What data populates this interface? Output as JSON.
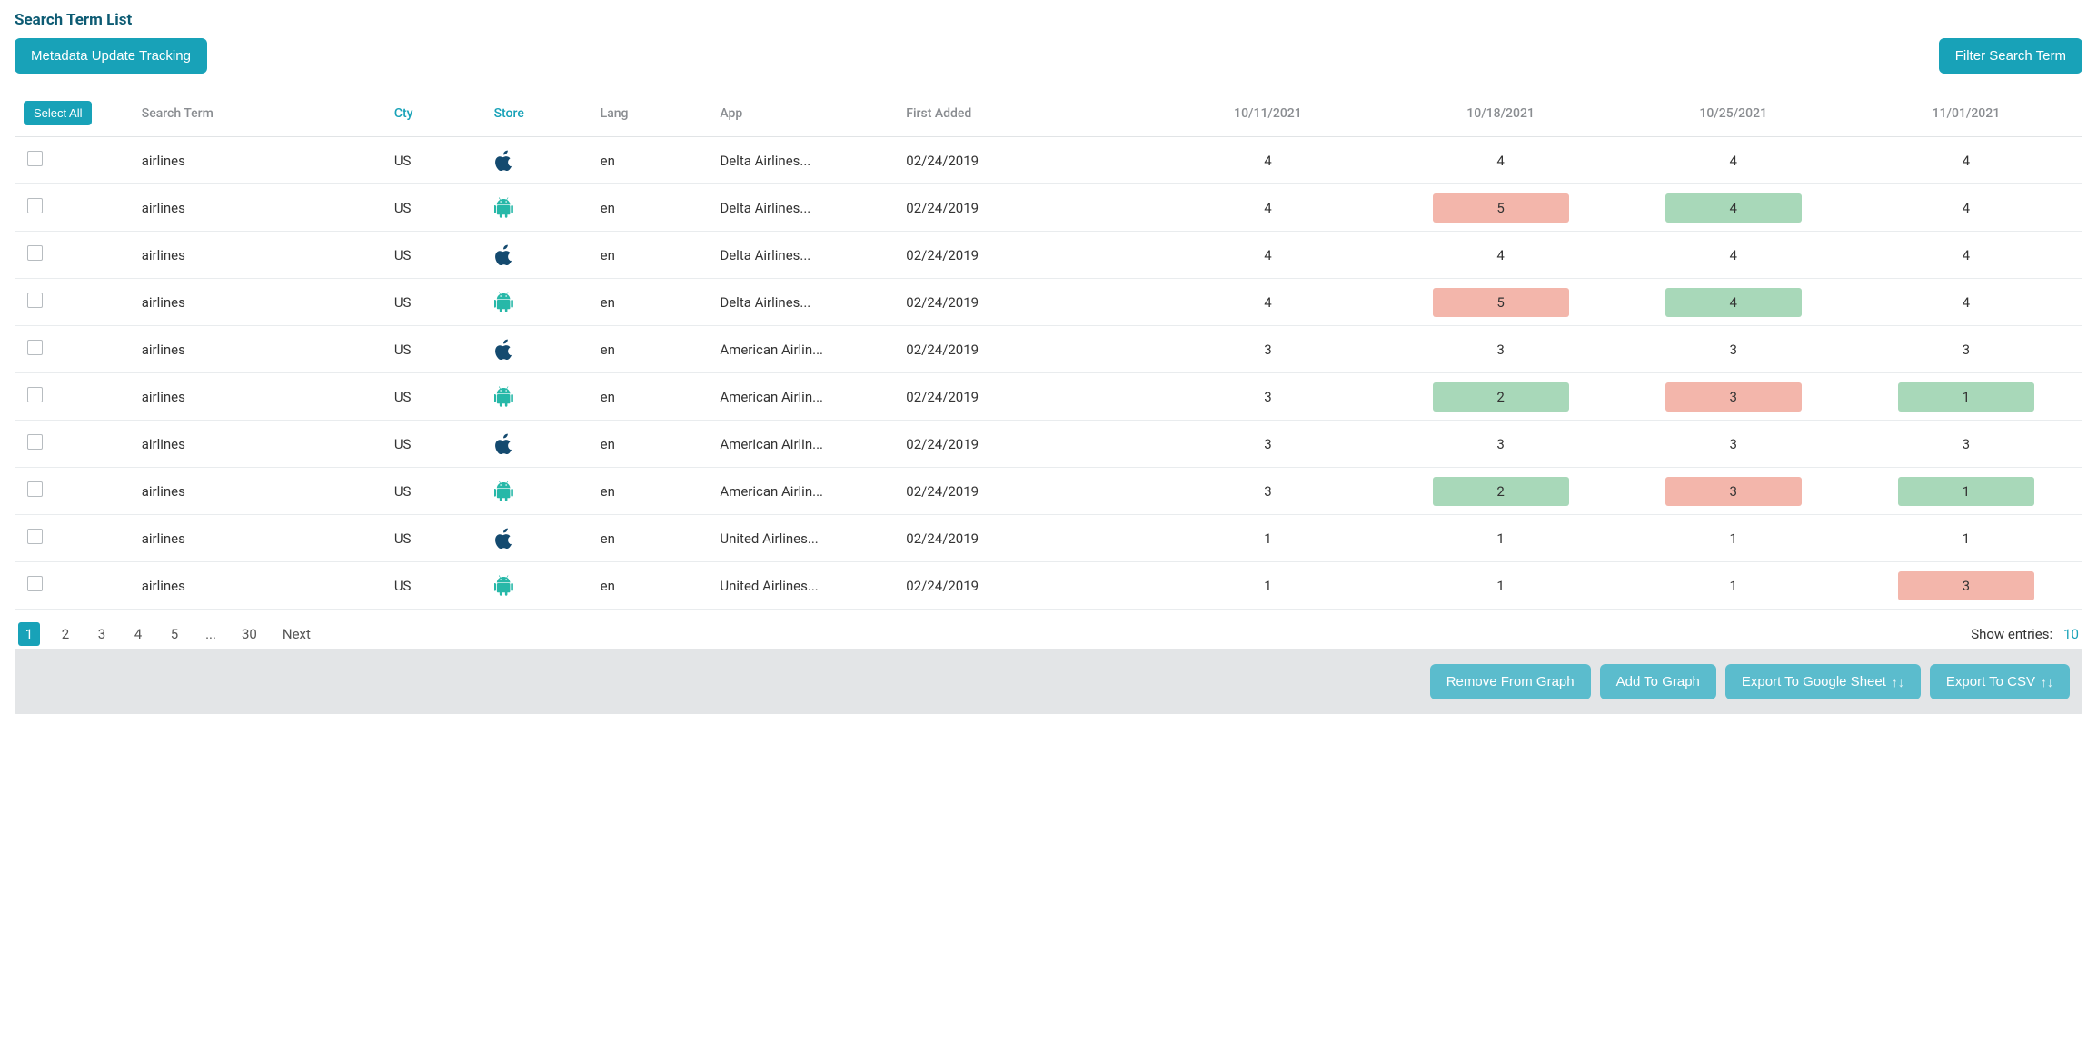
{
  "title": "Search Term List",
  "topbar": {
    "metadata_btn": "Metadata Update Tracking",
    "filter_btn": "Filter Search Term"
  },
  "columns": {
    "select_all": "Select All",
    "search_term": "Search Term",
    "cty": "Cty",
    "store": "Store",
    "lang": "Lang",
    "app": "App",
    "first_added": "First Added",
    "dates": [
      "10/11/2021",
      "10/18/2021",
      "10/25/2021",
      "11/01/2021"
    ]
  },
  "rows": [
    {
      "term": "airlines",
      "cty": "US",
      "store": "apple",
      "lang": "en",
      "app": "Delta Airlines...",
      "added": "02/24/2019",
      "vals": [
        {
          "v": "4"
        },
        {
          "v": "4"
        },
        {
          "v": "4"
        },
        {
          "v": "4"
        }
      ]
    },
    {
      "term": "airlines",
      "cty": "US",
      "store": "android",
      "lang": "en",
      "app": "Delta Airlines...",
      "added": "02/24/2019",
      "vals": [
        {
          "v": "4"
        },
        {
          "v": "5",
          "c": "red"
        },
        {
          "v": "4",
          "c": "green"
        },
        {
          "v": "4"
        }
      ]
    },
    {
      "term": "airlines",
      "cty": "US",
      "store": "apple",
      "lang": "en",
      "app": "Delta Airlines...",
      "added": "02/24/2019",
      "vals": [
        {
          "v": "4"
        },
        {
          "v": "4"
        },
        {
          "v": "4"
        },
        {
          "v": "4"
        }
      ]
    },
    {
      "term": "airlines",
      "cty": "US",
      "store": "android",
      "lang": "en",
      "app": "Delta Airlines...",
      "added": "02/24/2019",
      "vals": [
        {
          "v": "4"
        },
        {
          "v": "5",
          "c": "red"
        },
        {
          "v": "4",
          "c": "green"
        },
        {
          "v": "4"
        }
      ]
    },
    {
      "term": "airlines",
      "cty": "US",
      "store": "apple",
      "lang": "en",
      "app": "American Airlin...",
      "added": "02/24/2019",
      "vals": [
        {
          "v": "3"
        },
        {
          "v": "3"
        },
        {
          "v": "3"
        },
        {
          "v": "3"
        }
      ]
    },
    {
      "term": "airlines",
      "cty": "US",
      "store": "android",
      "lang": "en",
      "app": "American Airlin...",
      "added": "02/24/2019",
      "vals": [
        {
          "v": "3"
        },
        {
          "v": "2",
          "c": "green"
        },
        {
          "v": "3",
          "c": "red"
        },
        {
          "v": "1",
          "c": "green"
        }
      ]
    },
    {
      "term": "airlines",
      "cty": "US",
      "store": "apple",
      "lang": "en",
      "app": "American Airlin...",
      "added": "02/24/2019",
      "vals": [
        {
          "v": "3"
        },
        {
          "v": "3"
        },
        {
          "v": "3"
        },
        {
          "v": "3"
        }
      ]
    },
    {
      "term": "airlines",
      "cty": "US",
      "store": "android",
      "lang": "en",
      "app": "American Airlin...",
      "added": "02/24/2019",
      "vals": [
        {
          "v": "3"
        },
        {
          "v": "2",
          "c": "green"
        },
        {
          "v": "3",
          "c": "red"
        },
        {
          "v": "1",
          "c": "green"
        }
      ]
    },
    {
      "term": "airlines",
      "cty": "US",
      "store": "apple",
      "lang": "en",
      "app": "United Airlines...",
      "added": "02/24/2019",
      "vals": [
        {
          "v": "1"
        },
        {
          "v": "1"
        },
        {
          "v": "1"
        },
        {
          "v": "1"
        }
      ]
    },
    {
      "term": "airlines",
      "cty": "US",
      "store": "android",
      "lang": "en",
      "app": "United Airlines...",
      "added": "02/24/2019",
      "vals": [
        {
          "v": "1"
        },
        {
          "v": "1"
        },
        {
          "v": "1"
        },
        {
          "v": "3",
          "c": "red"
        }
      ]
    }
  ],
  "pager": {
    "pages": [
      "1",
      "2",
      "3",
      "4",
      "5",
      "...",
      "30",
      "Next"
    ],
    "active": "1",
    "show_entries_label": "Show entries:",
    "show_entries_value": "10"
  },
  "actions": {
    "remove": "Remove From Graph",
    "add": "Add To Graph",
    "export_sheet": "Export To Google Sheet",
    "export_csv": "Export To CSV"
  }
}
